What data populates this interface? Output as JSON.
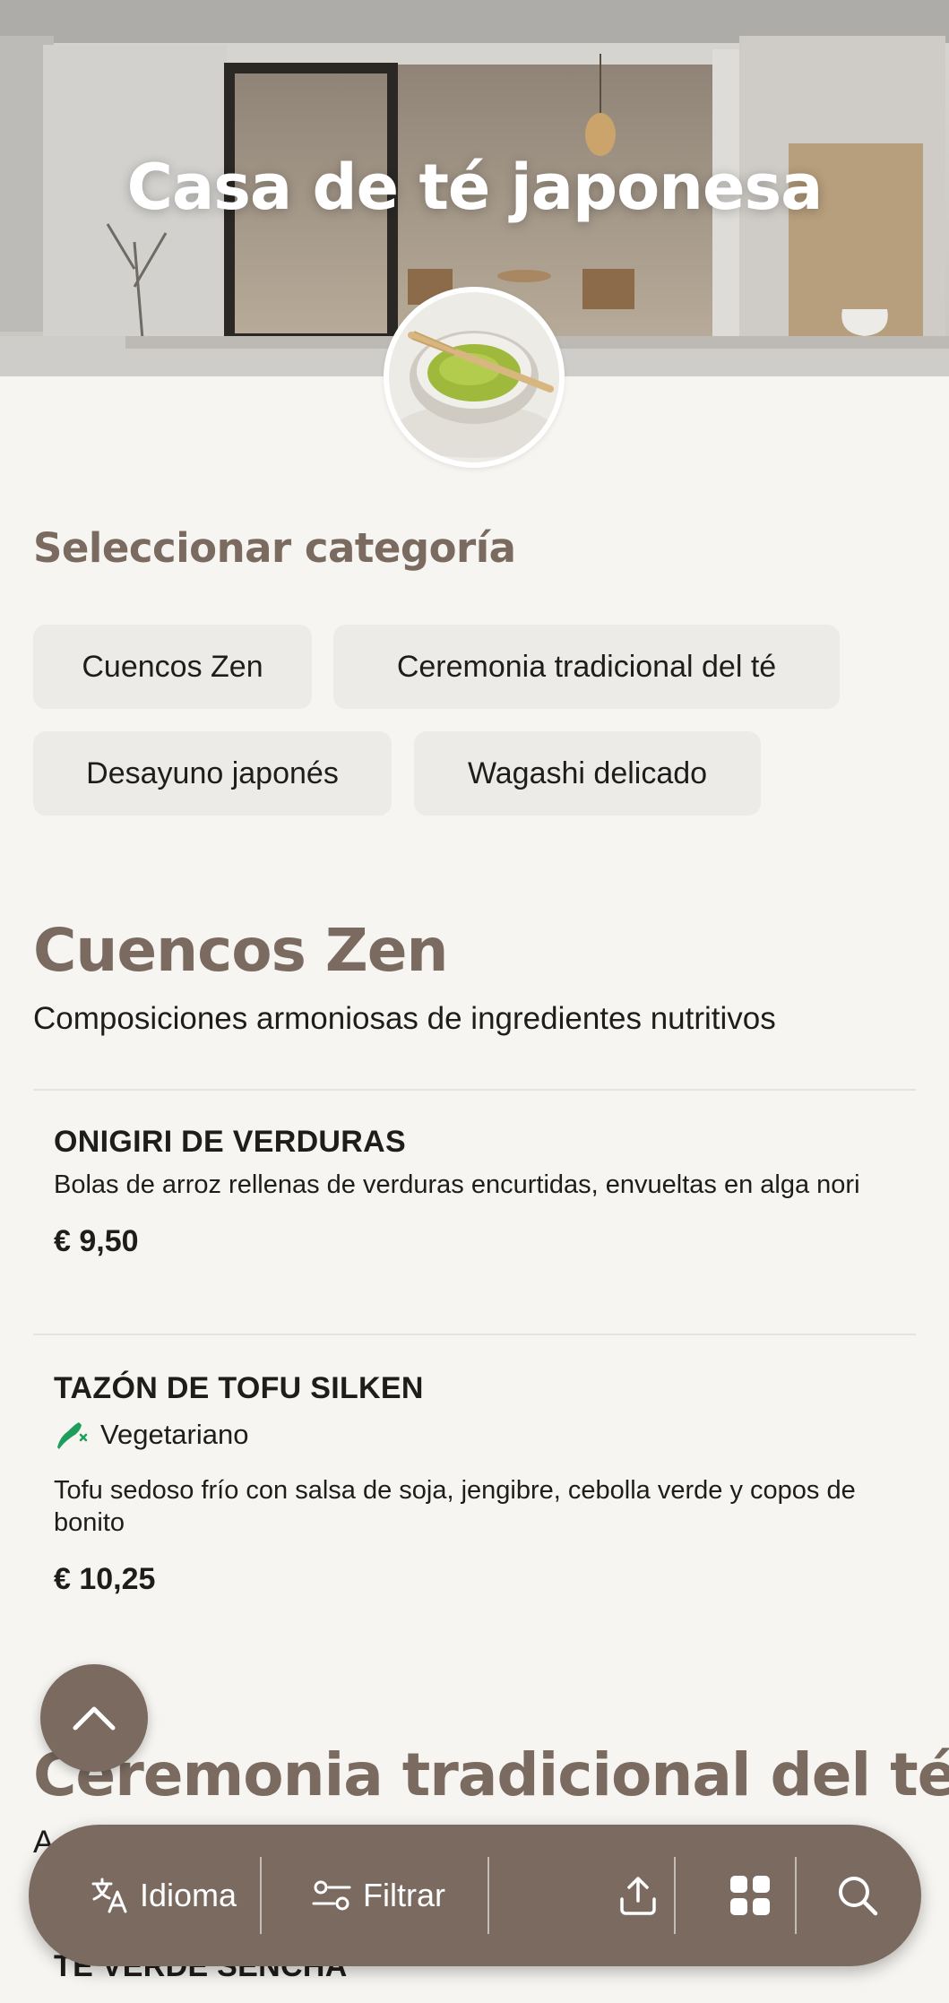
{
  "restaurant": {
    "name": "Casa de té japonesa"
  },
  "category_selector": {
    "heading": "Seleccionar categoría",
    "chips": [
      "Cuencos Zen",
      "Ceremonia tradicional del té",
      "Desayuno japonés",
      "Wagashi delicado"
    ]
  },
  "sections": [
    {
      "title": "Cuencos Zen",
      "description": "Composiciones armoniosas de ingredientes nutritivos",
      "items": [
        {
          "name": "ONIGIRI DE VERDURAS",
          "description": "Bolas de arroz rellenas de verduras encurtidas, envueltas en alga nori",
          "price": "€ 9,50"
        },
        {
          "name": "TAZÓN DE TOFU SILKEN",
          "tag": "Vegetariano",
          "description": "Tofu sedoso frío con salsa de soja, jengibre, cebolla verde y copos de bonito",
          "price": "€ 10,25"
        }
      ]
    },
    {
      "title": "Ceremonia tradicional del té",
      "description_visible": "A",
      "items": [
        {
          "name": "TÉ VERDE SENCHA"
        }
      ]
    }
  ],
  "bottom_bar": {
    "language_label": "Idioma",
    "filter_label": "Filtrar",
    "icons": [
      "translate-icon",
      "filter-icon",
      "share-icon",
      "grid-icon",
      "search-icon"
    ]
  },
  "colors": {
    "accent": "#7a6a60",
    "background": "#f6f5f1",
    "chip": "#ecebe7",
    "vegetarian": "#1e9e5a"
  }
}
